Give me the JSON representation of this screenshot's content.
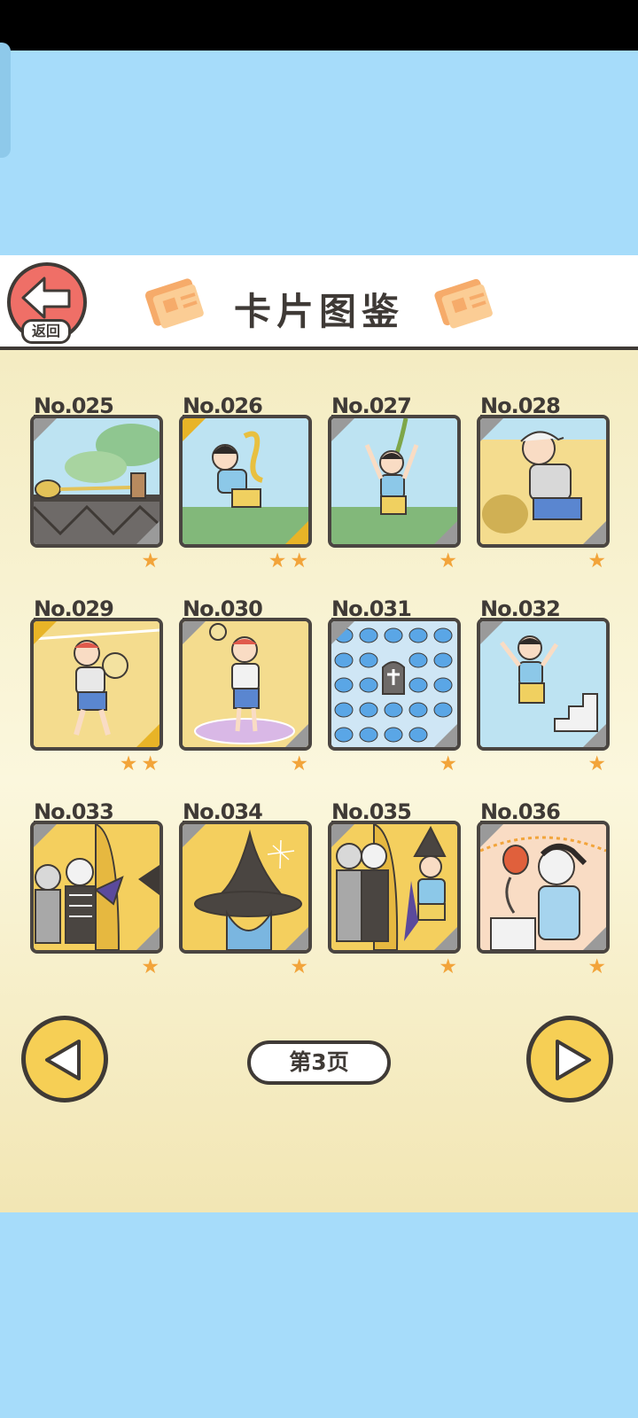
{
  "header": {
    "title": "卡片图鉴",
    "back_label": "返回"
  },
  "cards": [
    {
      "number": "No.025",
      "stars": "★",
      "frame": "silver",
      "scene": "rope-on-bridge"
    },
    {
      "number": "No.026",
      "stars": "★★",
      "frame": "gold",
      "scene": "boy-with-snake"
    },
    {
      "number": "No.027",
      "stars": "★",
      "frame": "silver",
      "scene": "boy-on-rope-swing"
    },
    {
      "number": "No.028",
      "stars": "★",
      "frame": "silver",
      "scene": "boy-with-cap-kicking"
    },
    {
      "number": "No.029",
      "stars": "★★",
      "frame": "gold",
      "scene": "boy-hit-by-ball"
    },
    {
      "number": "No.030",
      "stars": "★",
      "frame": "silver",
      "scene": "boy-spinning-ball"
    },
    {
      "number": "No.031",
      "stars": "★",
      "frame": "silver",
      "scene": "slimes-and-tombstone"
    },
    {
      "number": "No.032",
      "stars": "★",
      "frame": "silver",
      "scene": "boy-climbing-stairs"
    },
    {
      "number": "No.033",
      "stars": "★",
      "frame": "silver",
      "scene": "halloween-group"
    },
    {
      "number": "No.034",
      "stars": "★",
      "frame": "silver",
      "scene": "witch-hat"
    },
    {
      "number": "No.035",
      "stars": "★",
      "frame": "silver",
      "scene": "halloween-costumes"
    },
    {
      "number": "No.036",
      "stars": "★",
      "frame": "silver",
      "scene": "boy-with-gift"
    }
  ],
  "pagination": {
    "current_label": "第3页"
  },
  "colors": {
    "sky": "#a6dcfa",
    "panel": "#fbf6da",
    "outline": "#3f3a36",
    "star": "#f2a43a",
    "gold_corner": "#e8b427",
    "nav_button": "#f6cf55",
    "back_button": "#ef6f67"
  }
}
